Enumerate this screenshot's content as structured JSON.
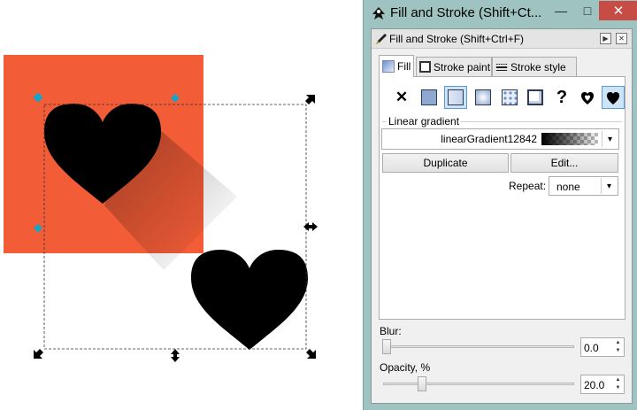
{
  "window": {
    "title": "Fill and Stroke (Shift+Ct...",
    "min_glyph": "—",
    "max_glyph": "□",
    "close_glyph": "✕"
  },
  "panel": {
    "title": "Fill and Stroke (Shift+Ctrl+F)",
    "arrow_glyph": "▶",
    "close_glyph": "✕"
  },
  "tabs": [
    {
      "label": "Fill",
      "active": true
    },
    {
      "label": "Stroke paint",
      "active": false
    },
    {
      "label": "Stroke style",
      "active": false
    }
  ],
  "paint_modes": {
    "none_glyph": "✕",
    "unset_glyph": "?",
    "selected": "linear-gradient"
  },
  "gradient": {
    "section_label": "Linear gradient",
    "name": "linearGradient12842",
    "duplicate_label": "Duplicate",
    "edit_label": "Edit...",
    "repeat_label": "Repeat:",
    "repeat_value": "none",
    "drop_glyph": "▾"
  },
  "blur": {
    "label": "Blur:",
    "value": "0.0"
  },
  "opacity": {
    "label": "Opacity, %",
    "value": "20.0"
  },
  "colors": {
    "canvas_square": "#f25c37",
    "heart": "#000000",
    "close_button": "#c74c44",
    "window_frame": "#9fc3c1",
    "selected_highlight": "#cde4f7",
    "handle_cyan": "#17a3c8"
  }
}
